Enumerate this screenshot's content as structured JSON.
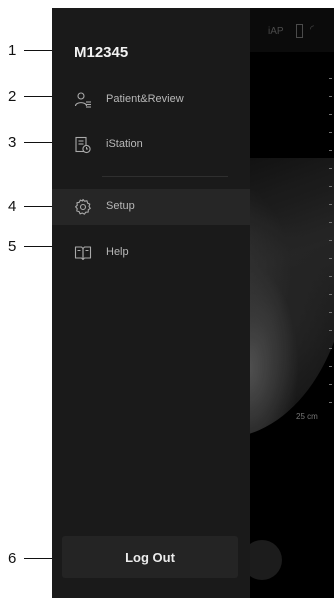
{
  "device": {
    "name": "M12345"
  },
  "menu": {
    "items": [
      {
        "label": "Patient&Review",
        "icon": "patient-list-icon",
        "active": false
      },
      {
        "label": "iStation",
        "icon": "document-clock-icon",
        "active": false
      },
      {
        "label": "Setup",
        "icon": "gear-icon",
        "active": true
      },
      {
        "label": "Help",
        "icon": "book-icon",
        "active": false
      }
    ],
    "logout_label": "Log Out"
  },
  "callouts": [
    "1",
    "2",
    "3",
    "4",
    "5",
    "6"
  ],
  "background": {
    "status_text": "iAP",
    "depth_label": "25 cm"
  },
  "colors": {
    "drawer_bg": "#1a1a1a",
    "active_item_bg": "#262626",
    "text_primary": "#f2f2f2",
    "text_secondary": "#b8b8b8"
  }
}
